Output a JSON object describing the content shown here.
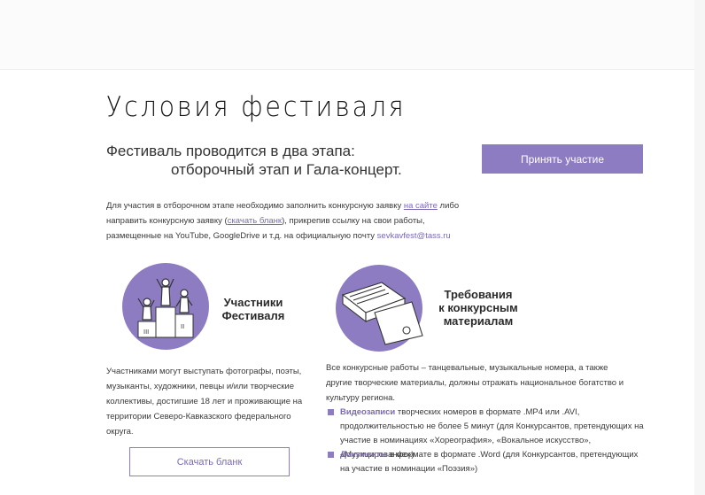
{
  "page": {
    "title": "Условия фестиваля",
    "intro_line1": "Фестиваль проводится в два этапа:",
    "intro_line2": "отборочный этап и Гала-концерт.",
    "join_button": "Принять участие"
  },
  "info": {
    "text1": "Для участия в отборочном этапе необходимо заполнить конкурсную заявку ",
    "link1": "на сайте",
    "text2": " либо направить конкурсную заявку (",
    "link2": "скачать бланк",
    "text3": "), прикрепив ссылку на свои работы, размещенные на YouTube, GoogleDrive и т.д. на официальную почту ",
    "email": "sevkavfest@tass.ru"
  },
  "participants": {
    "heading_line1": "Участники",
    "heading_line2": "Фестиваля",
    "body": "Участниками могут выступать фотографы, поэты, музыканты, художники, певцы и/или творческие коллективы, достигшие 18 лет и проживающие на территории Северо-Кавказского федерального округа.",
    "download_button": "Скачать бланк",
    "icon": "podium-icon"
  },
  "requirements": {
    "heading_line1": "Требования",
    "heading_line2": "к конкурсным",
    "heading_line3": "материалам",
    "body": "Все конкурсные работы – танцевальные, музыкальные номера, а также другие творческие материалы, должны отражать национальное богатство и культуру региона.",
    "bullet1_highlight": "Видеозаписи",
    "bullet1_text": " творческих номеров в формате .MP4 или .AVI, продолжительностью  не более 5 минут (для Конкурсантов, претендующих на участие в номинациях «Хореография», «Вокальное искусство», «Музицирование»)",
    "bullet2_highlight": "Документы",
    "bullet2_text": " в формате в формате .Word (для Конкурсантов, претендующих на участие в номинации «Поэзия»)",
    "icon": "documents-icon"
  },
  "colors": {
    "accent": "#8e7cc3",
    "link": "#7b69b4",
    "text": "#2a2a2a"
  }
}
